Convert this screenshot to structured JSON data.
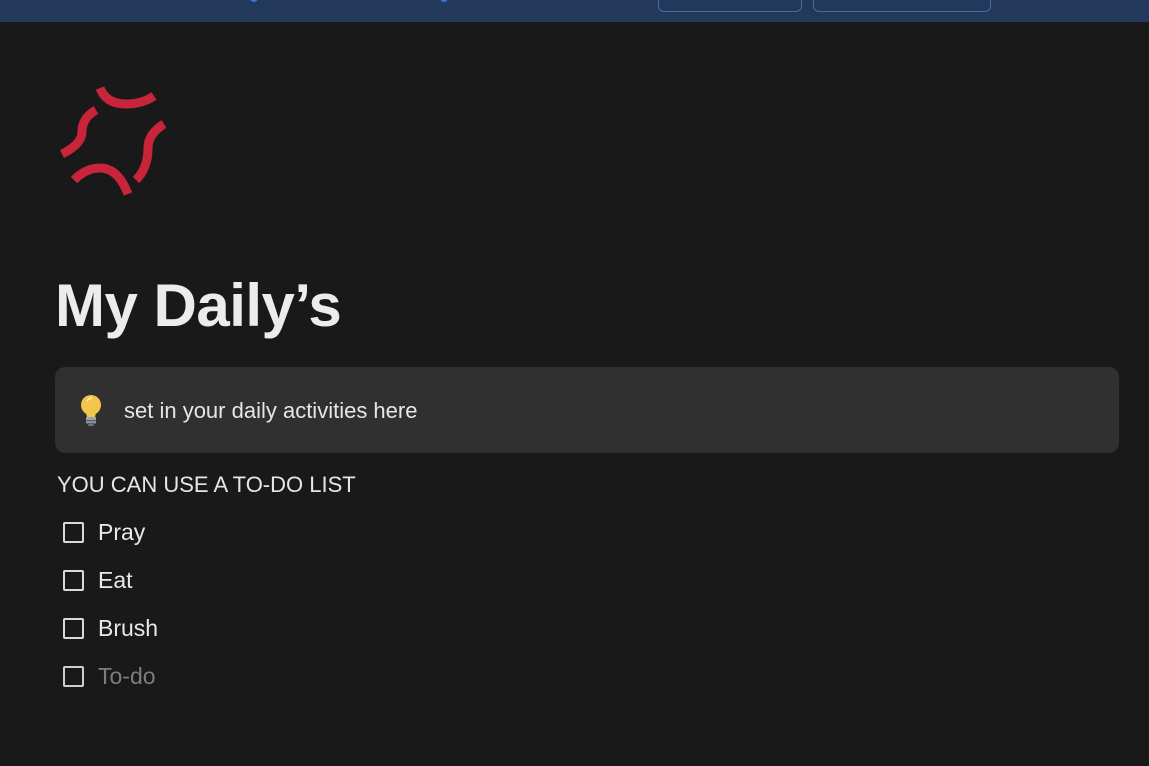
{
  "page": {
    "title": "My Daily’s",
    "icon": "anger-symbol-icon",
    "icon_color": "#c8243a"
  },
  "callout": {
    "icon": "light-bulb-icon",
    "text": "set in your daily activities here"
  },
  "heading": {
    "text": "YOU CAN USE A TO-DO LIST"
  },
  "todos": [
    {
      "label": "Pray",
      "checked": false
    },
    {
      "label": "Eat",
      "checked": false
    },
    {
      "label": "Brush",
      "checked": false
    }
  ],
  "todo_placeholder": {
    "label": "To-do",
    "checked": false
  },
  "colors": {
    "background": "#191919",
    "callout_bg": "#303030",
    "topbar_bg": "#23395b",
    "text": "#e6e6e6",
    "placeholder_text": "#7d7d7d"
  }
}
